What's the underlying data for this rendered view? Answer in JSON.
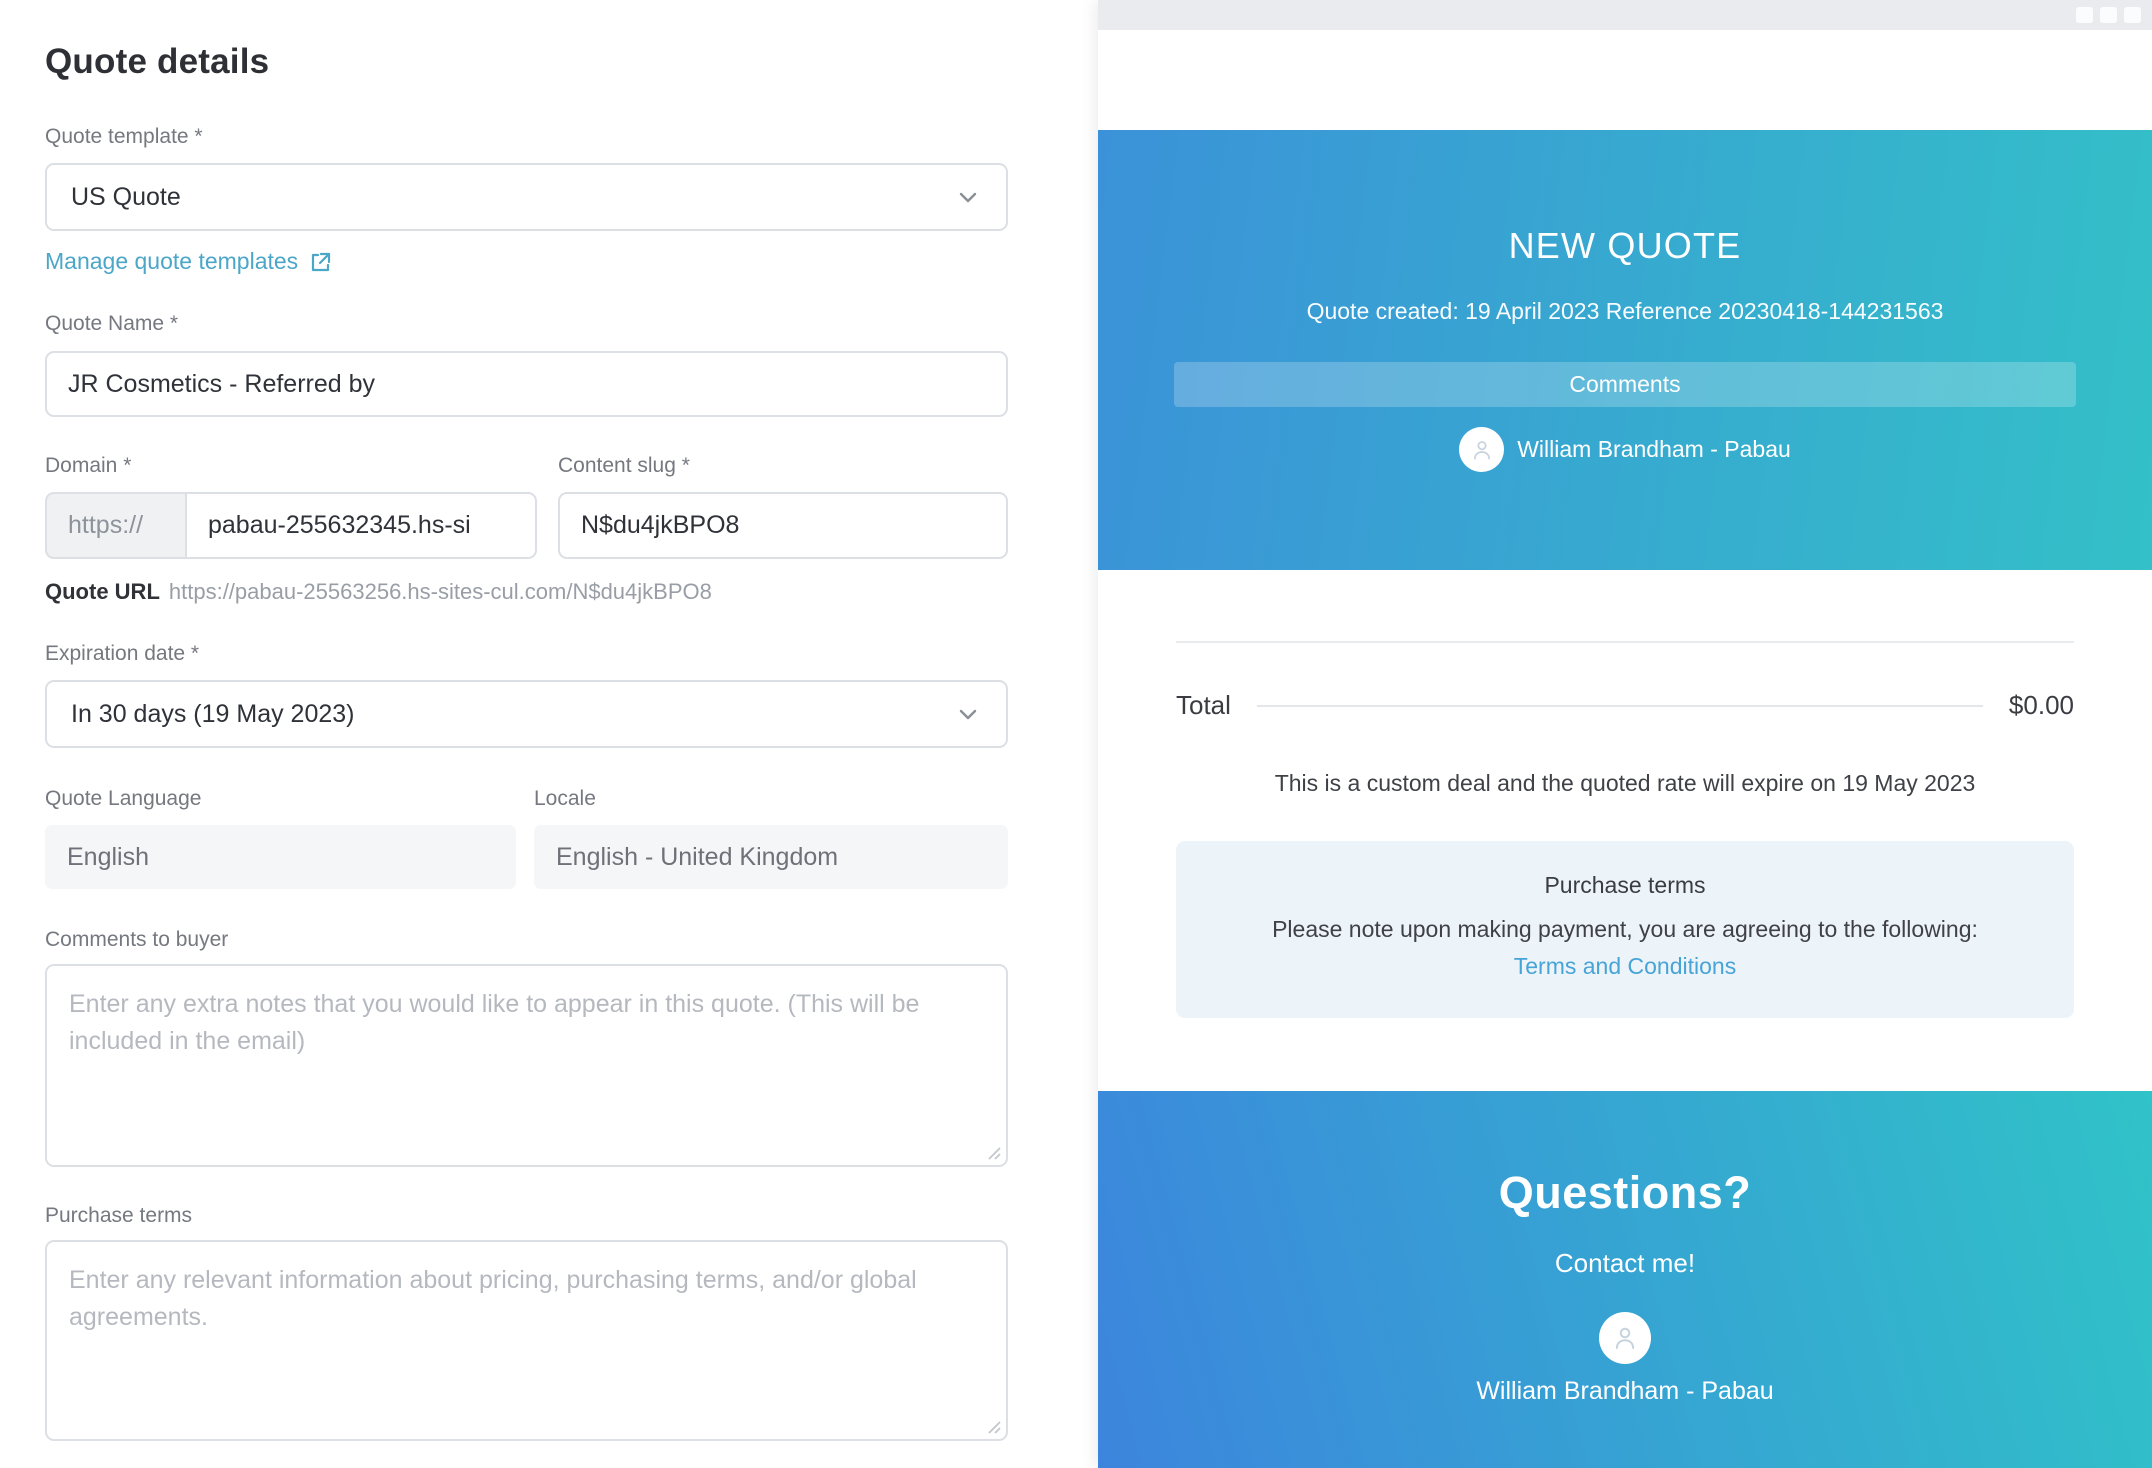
{
  "form": {
    "title": "Quote details",
    "template": {
      "label": "Quote template *",
      "value": "US Quote"
    },
    "manage_link_label": "Manage quote templates",
    "name": {
      "label": "Quote Name *",
      "value": "JR Cosmetics - Referred by"
    },
    "domain": {
      "label": "Domain *",
      "protocol": "https://",
      "value": "pabau-255632345.hs-si"
    },
    "slug": {
      "label": "Content slug *",
      "value": "N$du4jkBPO8"
    },
    "quote_url": {
      "label": "Quote URL",
      "value": "https://pabau-25563256.hs-sites-cul.com/N$du4jkBPO8"
    },
    "expiration": {
      "label": "Expiration date *",
      "value": "In 30 days (19 May 2023)"
    },
    "language": {
      "label": "Quote Language",
      "value": "English"
    },
    "locale": {
      "label": "Locale",
      "value": "English - United Kingdom"
    },
    "comments": {
      "label": "Comments to buyer",
      "placeholder": "Enter any extra notes that you would like to appear in this quote. (This will be included in the email)"
    },
    "purchase_terms": {
      "label": "Purchase terms",
      "placeholder": "Enter any relevant information about pricing, purchasing terms, and/or global agreements."
    }
  },
  "preview": {
    "hero": {
      "title": "NEW QUOTE",
      "subtitle": "Quote created: 19 April 2023 Reference 20230418-144231563",
      "comments_button": "Comments",
      "owner": "William Brandham - Pabau"
    },
    "totals": {
      "label": "Total",
      "amount": "$0.00",
      "note": "This is a custom deal and the quoted rate will expire on 19 May 2023"
    },
    "terms": {
      "title": "Purchase terms",
      "note": "Please note upon making payment, you are agreeing to the following:",
      "link": "Terms and Conditions"
    },
    "footer": {
      "title": "Questions?",
      "subtitle": "Contact me!",
      "owner": "William Brandham - Pabau"
    }
  },
  "icons": {
    "chevron_down": "⌄",
    "external_link": "↗",
    "person": "👤",
    "window_control": "▢",
    "resize_handle": "⋰"
  },
  "colors": {
    "hero_gradient_from": "#3b92d8",
    "hero_gradient_to": "#33c0c8",
    "footer_gradient_from": "#3c85dd",
    "footer_gradient_to": "#30c3c8",
    "manage_link": "#4ba6c8",
    "terms_link": "#47a4d7",
    "terms_box_bg": "#ecf3f9",
    "window_bar_bg": "#e9ebee"
  }
}
